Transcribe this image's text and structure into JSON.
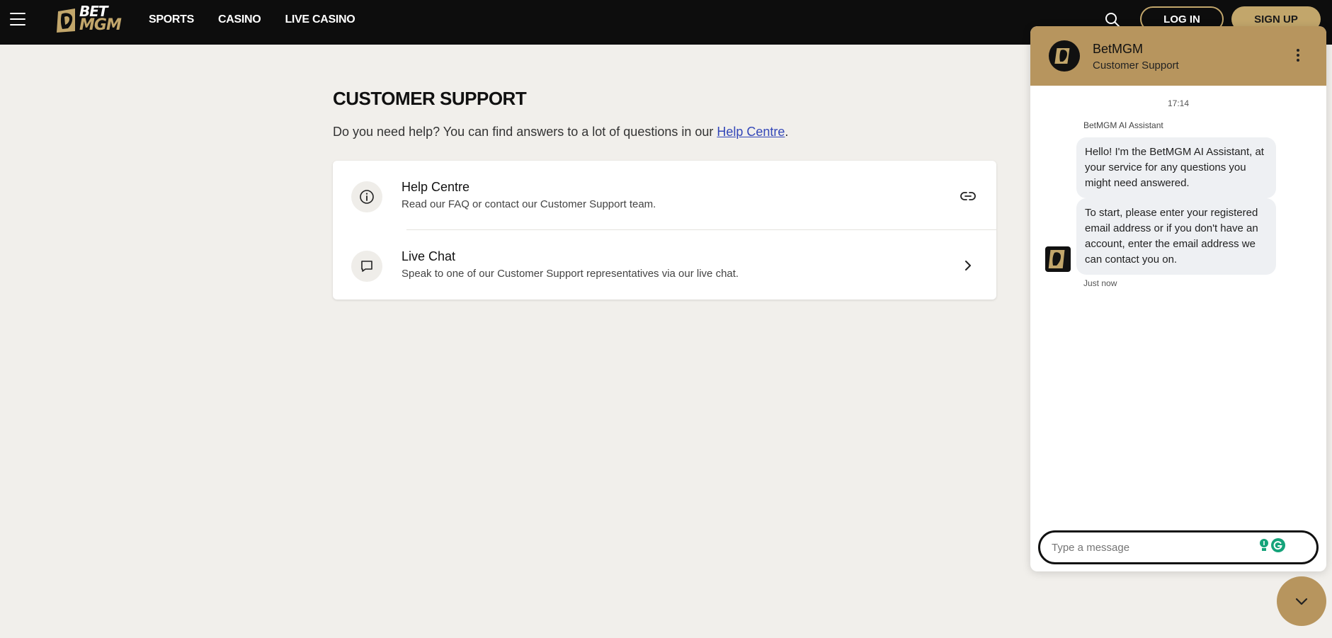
{
  "topbar": {
    "logo_bet": "BET",
    "logo_mgm": "MGM",
    "nav": [
      "SPORTS",
      "CASINO",
      "LIVE CASINO"
    ],
    "login_label": "LOG IN",
    "signup_label": "SIGN UP"
  },
  "main": {
    "title": "CUSTOMER SUPPORT",
    "intro_text": "Do you need help? You can find answers to a lot of questions in our ",
    "intro_link": "Help Centre",
    "intro_end": ".",
    "rows": [
      {
        "title": "Help Centre",
        "subtitle": "Read our FAQ or contact our Customer Support team."
      },
      {
        "title": "Live Chat",
        "subtitle": "Speak to one of our Customer Support representatives via our live chat."
      }
    ]
  },
  "chat": {
    "name": "BetMGM",
    "subtitle": "Customer Support",
    "time": "17:14",
    "sender": "BetMGM AI Assistant",
    "messages": [
      "Hello! I'm the BetMGM AI Assistant, at your service for any questions you might need answered.",
      "To start, please enter your registered email address or if you don't have an account, enter the email address we can contact you on."
    ],
    "message_meta": "Just now",
    "input_placeholder": "Type a message"
  },
  "colors": {
    "gold": "#c2a66b",
    "chat_header": "#b7955e",
    "nav_bg": "#0d0d0d",
    "page_bg": "#f1efeb",
    "link": "#3347b8"
  }
}
